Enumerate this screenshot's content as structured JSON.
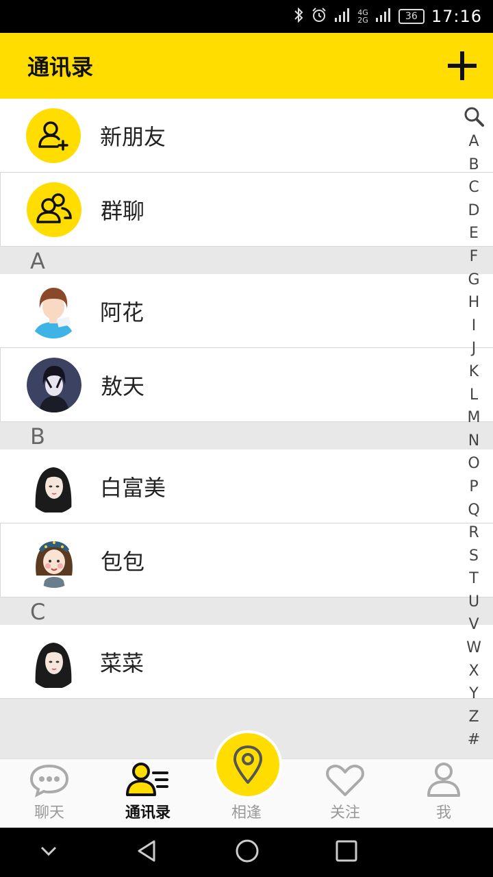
{
  "status": {
    "signal_top": "4G",
    "signal_bottom": "2G",
    "battery": "36",
    "time": "17:16"
  },
  "header": {
    "title": "通讯录"
  },
  "special_rows": [
    {
      "label": "新朋友",
      "icon": "add-person-icon"
    },
    {
      "label": "群聊",
      "icon": "group-icon"
    }
  ],
  "sections": [
    {
      "letter": "A",
      "contacts": [
        {
          "name": "阿花"
        },
        {
          "name": "敖天"
        }
      ]
    },
    {
      "letter": "B",
      "contacts": [
        {
          "name": "白富美"
        },
        {
          "name": "包包"
        }
      ]
    },
    {
      "letter": "C",
      "contacts": [
        {
          "name": "菜菜"
        }
      ]
    }
  ],
  "index_letters": [
    "A",
    "B",
    "C",
    "D",
    "E",
    "F",
    "G",
    "H",
    "I",
    "J",
    "K",
    "L",
    "M",
    "N",
    "O",
    "P",
    "Q",
    "R",
    "S",
    "T",
    "U",
    "V",
    "W",
    "X",
    "Y",
    "Z",
    "#"
  ],
  "tabs": [
    {
      "label": "聊天",
      "icon": "chat-icon",
      "active": false
    },
    {
      "label": "通讯录",
      "icon": "contacts-icon",
      "active": true
    },
    {
      "label": "相逢",
      "icon": "location-pin-icon",
      "active": false
    },
    {
      "label": "关注",
      "icon": "heart-icon",
      "active": false
    },
    {
      "label": "我",
      "icon": "person-icon",
      "active": false
    }
  ],
  "colors": {
    "accent": "#ffdd00",
    "background": "#e8e8e8"
  }
}
